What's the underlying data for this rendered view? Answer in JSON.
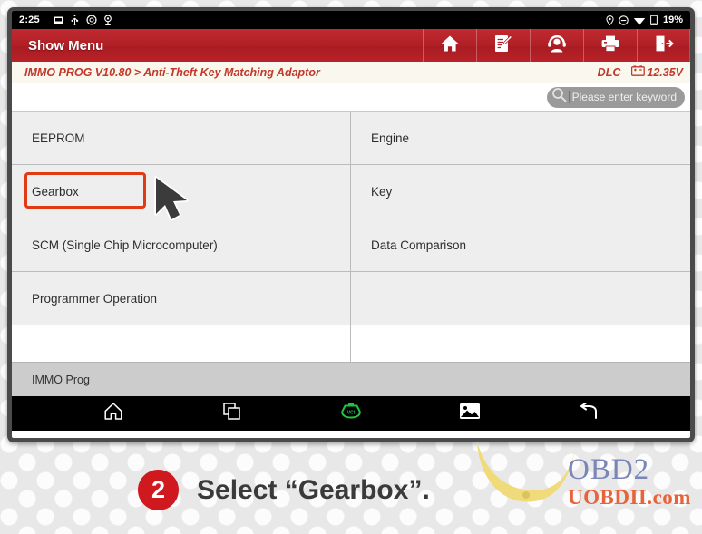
{
  "status_bar": {
    "time": "2:25",
    "battery_percent": "19%",
    "left_icons": [
      "screenshot-icon",
      "usb-icon",
      "settings-gear-icon",
      "location-pin-icon"
    ],
    "right_icons": [
      "location-pin-icon",
      "do-not-disturb-icon",
      "wifi-icon",
      "battery-icon"
    ]
  },
  "title_bar": {
    "title": "Show Menu",
    "buttons": [
      {
        "name": "home-button",
        "icon": "home-icon"
      },
      {
        "name": "notes-button",
        "icon": "edit-note-icon"
      },
      {
        "name": "support-button",
        "icon": "headset-person-icon"
      },
      {
        "name": "print-button",
        "icon": "printer-icon"
      },
      {
        "name": "exit-button",
        "icon": "exit-door-icon"
      }
    ]
  },
  "path_bar": {
    "breadcrumb": "IMMO PROG V10.80 > Anti-Theft Key Matching Adaptor",
    "dlc_label": "DLC",
    "voltage": "12.35V"
  },
  "search": {
    "placeholder": "Please enter keyword",
    "value": ""
  },
  "menu": {
    "items": [
      {
        "label": "EEPROM",
        "column": "left",
        "selected": false
      },
      {
        "label": "Engine",
        "column": "right",
        "selected": false
      },
      {
        "label": "Gearbox",
        "column": "left",
        "selected": true
      },
      {
        "label": "Key",
        "column": "right",
        "selected": false
      },
      {
        "label": "SCM (Single Chip Microcomputer)",
        "column": "left",
        "selected": false
      },
      {
        "label": "Data Comparison",
        "column": "right",
        "selected": false
      },
      {
        "label": "Programmer Operation",
        "column": "left",
        "selected": false
      },
      {
        "label": "",
        "column": "right",
        "selected": false
      }
    ]
  },
  "app_bar": {
    "label": "IMMO Prog"
  },
  "nav_bar": {
    "buttons": [
      {
        "name": "nav-home-button",
        "icon": "home-outline-icon"
      },
      {
        "name": "nav-recents-button",
        "icon": "recents-squares-icon"
      },
      {
        "name": "nav-vci-button",
        "icon": "vci-connector-icon"
      },
      {
        "name": "nav-screenshot-button",
        "icon": "image-icon"
      },
      {
        "name": "nav-back-button",
        "icon": "back-arrow-icon"
      }
    ],
    "vci_color": "#22c243"
  },
  "caption": {
    "step_number": "2",
    "text": "Select “Gearbox”."
  },
  "watermark": {
    "brand": "OBD2",
    "site": "UOBDII.com"
  },
  "colors": {
    "title_bar_red": "#b01f26",
    "highlight_red": "#e03b13",
    "badge_red": "#d0191e",
    "path_text_red": "#c0392b",
    "vci_green": "#22c243",
    "row_gray": "#eeeeee",
    "app_bar_gray": "#cccccc"
  }
}
